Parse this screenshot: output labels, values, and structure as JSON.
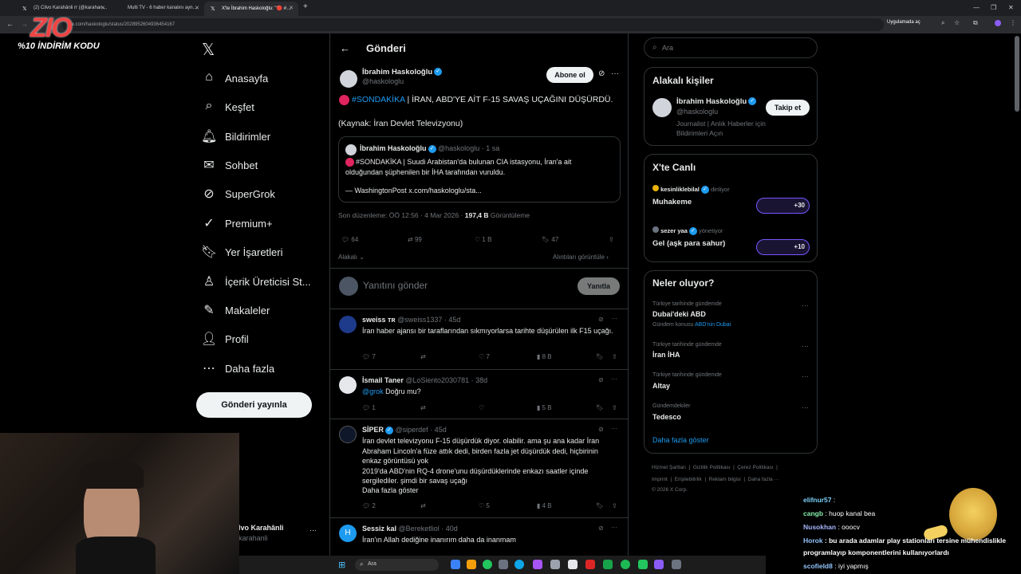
{
  "browser": {
    "tabs": [
      {
        "title": "(2) Cilvo Karahânli rr (@karahan…"
      },
      {
        "title": "Multi TV - 6 haber kanalını ayn…"
      },
      {
        "title": "X'te İbrahim Haskoloğlu: \"🔴 #…"
      }
    ],
    "url": "x.com/haskologlu/status/2028952604936454167",
    "app_button": "Uygulamada aç"
  },
  "overlay": {
    "logo": "ZIO",
    "promo": "%10 İNDİRİM KODU"
  },
  "nav": {
    "items": [
      {
        "icon": "home-icon",
        "label": "Anasayfa"
      },
      {
        "icon": "search-icon",
        "label": "Keşfet"
      },
      {
        "icon": "bell-icon",
        "label": "Bildirimler"
      },
      {
        "icon": "mail-icon",
        "label": "Sohbet"
      },
      {
        "icon": "grok-icon",
        "label": "SuperGrok"
      },
      {
        "icon": "premium-icon",
        "label": "Premium+"
      },
      {
        "icon": "bookmark-icon",
        "label": "Yer İşaretleri"
      },
      {
        "icon": "creator-icon",
        "label": "İçerik Üreticisi St..."
      },
      {
        "icon": "articles-icon",
        "label": "Makaleler"
      },
      {
        "icon": "profile-icon",
        "label": "Profil"
      },
      {
        "icon": "more-icon",
        "label": "Daha fazla"
      }
    ],
    "post_button": "Gönderi yayınla",
    "account_name": "Cilvo Karahânli",
    "account_handle": "@karahanli"
  },
  "post": {
    "header_title": "Gönderi",
    "author_name": "İbrahim Haskoloğlu",
    "author_handle": "@haskologlu",
    "subscribe": "Abone ol",
    "hashtag": "#SONDAKİKA",
    "text": " | İRAN, ABD'YE AİT F-15 SAVAŞ UÇAĞINI DÜŞÜRDÜ.",
    "source": "(Kaynak: İran Devlet Televizyonu)",
    "quote": {
      "author_name": "İbrahim Haskoloğlu",
      "author_handle": "@haskologlu",
      "time": "· 1 sa",
      "text": "#SONDAKİKA | Suudi Arabistan'da bulunan CIA istasyonu, İran'a ait olduğundan şüphenilen bir İHA tarafından vuruldu.",
      "link": "— WashingtonPost x.com/haskologlu/sta..."
    },
    "edited": "Son düzenleme: ÖÖ 12:56 · 4 Mar 2026 · ",
    "views_count": "197,4 B",
    "views_label": " Görüntüleme",
    "stats": {
      "replies": "64",
      "reposts": "99",
      "likes": "1 B",
      "bookmarks": "47"
    },
    "relevant": "Alakalı",
    "quotes_link": "Alıntıları görüntüle",
    "reply_placeholder": "Yanıtını gönder",
    "reply_button": "Yanıtla"
  },
  "replies": [
    {
      "name": "sweiss ᴛʀ",
      "handle": "@sweiss1337 · 45d",
      "text": "İran haber ajansı bir taraflarından sıkmıyorlarsa tarihte düşürülen ilk F15 uçağı.",
      "replies": "7",
      "likes": "7",
      "views": "8 B"
    },
    {
      "name": "İsmail Taner",
      "handle": "@LoSiento2030781 · 38d",
      "mention": "@grok",
      "text": " Doğru mu?",
      "replies": "1",
      "likes": "",
      "views": "5 B"
    },
    {
      "name": "SİPER",
      "handle": "@siperdef · 45d",
      "text": "İran devlet televizyonu F-15 düşürdük diyor. olabilir. ama şu ana kadar İran Abraham Lincoln'a füze attık dedi, birden fazla jet düşürdük dedi, hiçbirinin enkaz görüntüsü yok\n2019'da ABD'nin RQ-4 drone'unu düşürdüklerinde enkazı saatler içinde sergilediler. şimdi bir savaş uçağı",
      "more": "Daha fazla göster",
      "replies": "2",
      "likes": "5",
      "views": "4 B"
    },
    {
      "name": "Sessiz kal",
      "handle": "@Bereketliol · 40d",
      "text": "İran'ın Allah dediğine inanırım daha da inanmam"
    }
  ],
  "right": {
    "search_placeholder": "Ara",
    "relevant_title": "Alakalı kişiler",
    "relevant_name": "İbrahim Haskoloğlu",
    "relevant_handle": "@haskologlu",
    "relevant_bio": "Journalist | Anlık Haberler için Bildirimleri Açın",
    "follow": "Takip et",
    "live_title": "X'te Canlı",
    "live": [
      {
        "host": "kesinliklebilal",
        "role": "dinliyor",
        "title": "Muhakeme",
        "count": "+30"
      },
      {
        "host": "sezer yaa",
        "role": "yönetiyor",
        "title": "Gel (aşk para sahur)",
        "count": "+10"
      }
    ],
    "trends_title": "Neler oluyor?",
    "trends": [
      {
        "sub": "Türkiye tarihinde gündemde",
        "main": "Dubai'deki ABD",
        "extra_prefix": "Gündem konusu ",
        "extra_link": "ABD'nin Dubai"
      },
      {
        "sub": "Türkiye tarihinde gündemde",
        "main": "İran İHA"
      },
      {
        "sub": "Türkiye tarihinde gündemde",
        "main": "Altay"
      },
      {
        "sub": "Gündemdekiler",
        "main": "Tedesco"
      }
    ],
    "show_more": "Daha fazla göster",
    "footer_1": "Hizmet Şartları  |  Gizlilik Politikası  |  Çerez Politikası  |",
    "footer_2": "Imprint  |  Erişilebilirlik  |  Reklam bilgisi  |  Daha fazla ···",
    "footer_3": "© 2026 X Corp."
  },
  "chat": [
    {
      "user": "elifnur57",
      "msg": " : ",
      "color": "#7dd3fc"
    },
    {
      "user": "cangb",
      "msg": " : huop kanal bea",
      "color": "#86efac"
    },
    {
      "user": "Nusokhan",
      "msg": " : ooocv",
      "color": "#a5b4fc"
    },
    {
      "user": "Horok",
      "msg": " : bu arada adamlar play stationları tersine mühendislikle",
      "color": "#93c5fd"
    },
    {
      "user": "",
      "msg": "programlayıp komponentlerini kullanıyorlardı",
      "color": "#ffffff"
    },
    {
      "user": "scofield8",
      "msg": " : iyi yapmış",
      "color": "#93c5fd"
    }
  ],
  "taskbar": {
    "search": "Ara"
  }
}
